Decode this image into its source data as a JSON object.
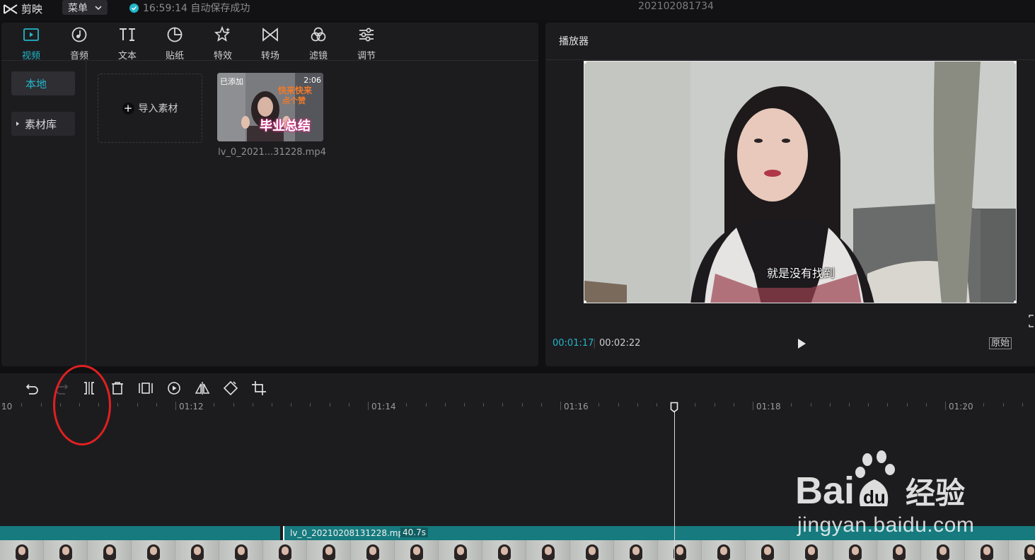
{
  "titlebar": {
    "app_name": "剪映",
    "menu_label": "菜单",
    "autosave_status": "16:59:14 自动保存成功",
    "project_title": "202102081734"
  },
  "media_panel": {
    "tabs": [
      {
        "label": "视频",
        "icon": "video-icon",
        "active": true
      },
      {
        "label": "音频",
        "icon": "audio-icon"
      },
      {
        "label": "文本",
        "icon": "text-icon"
      },
      {
        "label": "贴纸",
        "icon": "sticker-icon"
      },
      {
        "label": "特效",
        "icon": "effects-icon"
      },
      {
        "label": "转场",
        "icon": "transition-icon"
      },
      {
        "label": "滤镜",
        "icon": "filter-icon"
      },
      {
        "label": "调节",
        "icon": "adjust-icon"
      }
    ],
    "sidebar": {
      "local_label": "本地",
      "library_label": "素材库"
    },
    "import_label": "导入素材",
    "media_item": {
      "added_badge": "已添加",
      "duration": "2:06",
      "thumb_caption_top": "快来快来",
      "thumb_caption_mid": "点个赞",
      "thumb_title": "毕业总结",
      "filename": "lv_0_2021...31228.mp4"
    }
  },
  "player": {
    "title": "播放器",
    "subtitle": "就是没有找到",
    "current_time": "00:01:17",
    "separator": "|",
    "total_time": "00:02:22",
    "ratio_label": "原始"
  },
  "timeline": {
    "ruler_labels": [
      "10",
      "01:12",
      "01:14",
      "01:16",
      "01:18",
      "01:20"
    ],
    "clip_name": "lv_0_20210208131228.mp4",
    "clip_duration": "40.7s",
    "tools": [
      "undo-icon",
      "redo-icon",
      "split-icon",
      "delete-icon",
      "freeze-icon",
      "play-reverse-icon",
      "mirror-icon",
      "rotate-icon",
      "crop-icon"
    ]
  },
  "watermark": {
    "brand": "Bai",
    "brand_cn": "经验",
    "url": "jingyan.baidu.com"
  },
  "colors": {
    "accent": "#22b6c9",
    "clip": "#167a7e",
    "annotation": "#e02020"
  }
}
